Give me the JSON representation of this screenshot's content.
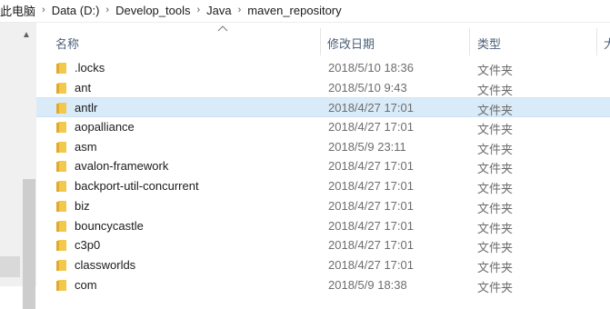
{
  "breadcrumb": [
    "此电脑",
    "Data (D:)",
    "Develop_tools",
    "Java",
    "maven_repository"
  ],
  "nav": {
    "scroll_up_glyph": "▲"
  },
  "columns": {
    "name": "名称",
    "date": "修改日期",
    "type": "类型",
    "size": "大"
  },
  "files": [
    {
      "name": ".locks",
      "date": "2018/5/10 18:36",
      "type": "文件夹"
    },
    {
      "name": "ant",
      "date": "2018/5/10 9:43",
      "type": "文件夹"
    },
    {
      "name": "antlr",
      "date": "2018/4/27 17:01",
      "type": "文件夹",
      "selected": true
    },
    {
      "name": "aopalliance",
      "date": "2018/4/27 17:01",
      "type": "文件夹"
    },
    {
      "name": "asm",
      "date": "2018/5/9 23:11",
      "type": "文件夹"
    },
    {
      "name": "avalon-framework",
      "date": "2018/4/27 17:01",
      "type": "文件夹"
    },
    {
      "name": "backport-util-concurrent",
      "date": "2018/4/27 17:01",
      "type": "文件夹"
    },
    {
      "name": "biz",
      "date": "2018/4/27 17:01",
      "type": "文件夹"
    },
    {
      "name": "bouncycastle",
      "date": "2018/4/27 17:01",
      "type": "文件夹"
    },
    {
      "name": "c3p0",
      "date": "2018/4/27 17:01",
      "type": "文件夹"
    },
    {
      "name": "classworlds",
      "date": "2018/4/27 17:01",
      "type": "文件夹"
    },
    {
      "name": "com",
      "date": "2018/5/9 18:38",
      "type": "文件夹"
    }
  ],
  "colors": {
    "folder": "#f2c94c",
    "folder_dark": "#e0a92f",
    "selected_row": "#d9ebf9"
  }
}
